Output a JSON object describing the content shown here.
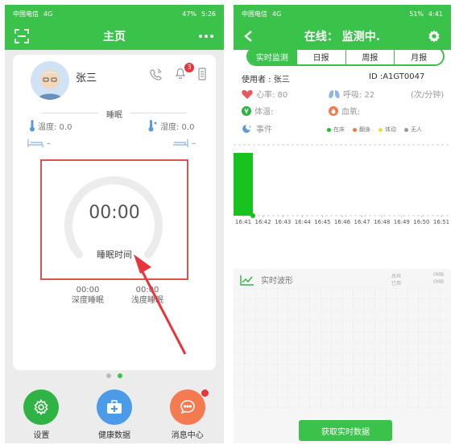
{
  "left": {
    "status": {
      "carrier": "中国电信",
      "signal": "4G",
      "battery": "47%",
      "time": "5:26"
    },
    "title": "主页",
    "user_name": "张三",
    "notification_count": "3",
    "section_title": "睡眠",
    "temperature": "温度: 0.0",
    "humidity": "湿度: 0.0",
    "bed_left_value": "–",
    "bed_right_value": "–",
    "sleep_time_value": "00:00",
    "sleep_time_label": "睡眠时间",
    "deep_sleep": {
      "value": "00:00",
      "label": "深度睡眠"
    },
    "light_sleep": {
      "value": "00:00",
      "label": "浅度睡眠"
    },
    "nav": [
      {
        "label": "设置",
        "color": "#2fb344"
      },
      {
        "label": "健康数据",
        "color": "#4b9be8"
      },
      {
        "label": "消息中心",
        "color": "#f47a4f"
      }
    ]
  },
  "right": {
    "status": {
      "carrier": "中国电信",
      "signal": "4G",
      "battery": "51%",
      "time": "4:41"
    },
    "title": "在线： 监测中.",
    "tabs": [
      "实时监测",
      "日报",
      "周报",
      "月报"
    ],
    "user_label": "使用者 : 张三",
    "id_label": "ID :A1GT0047",
    "heart_rate": "心率: 80",
    "breath": "呼吸: 22",
    "unit": "(次/分钟)",
    "temperature": "体温:",
    "blood_oxygen": "血氧:",
    "event": "事件",
    "legend": [
      {
        "label": "在床",
        "color": "#18c21f"
      },
      {
        "label": "翻身",
        "color": "#e8803a"
      },
      {
        "label": "体动",
        "color": "#e8e23a"
      },
      {
        "label": "无人",
        "color": "#9a9a9a"
      }
    ],
    "chart_data": {
      "type": "bar",
      "categories": [
        "16:41",
        "16:42",
        "16:43",
        "16:44",
        "16:45",
        "16:46",
        "16:47",
        "16:48",
        "16:49",
        "16:50",
        "16:51"
      ],
      "values": [
        1,
        0,
        0,
        0,
        0,
        0,
        0,
        0,
        0,
        0,
        0
      ],
      "title": "",
      "xlabel": "",
      "ylabel": "",
      "ylim": [
        0,
        1
      ]
    },
    "wave_title": "实时波形",
    "wave_meta": {
      "total_label": "总共",
      "total_value": "0MB",
      "used_label": "已用",
      "used_value": "0MB"
    },
    "fetch_button": "获取实时数据"
  }
}
